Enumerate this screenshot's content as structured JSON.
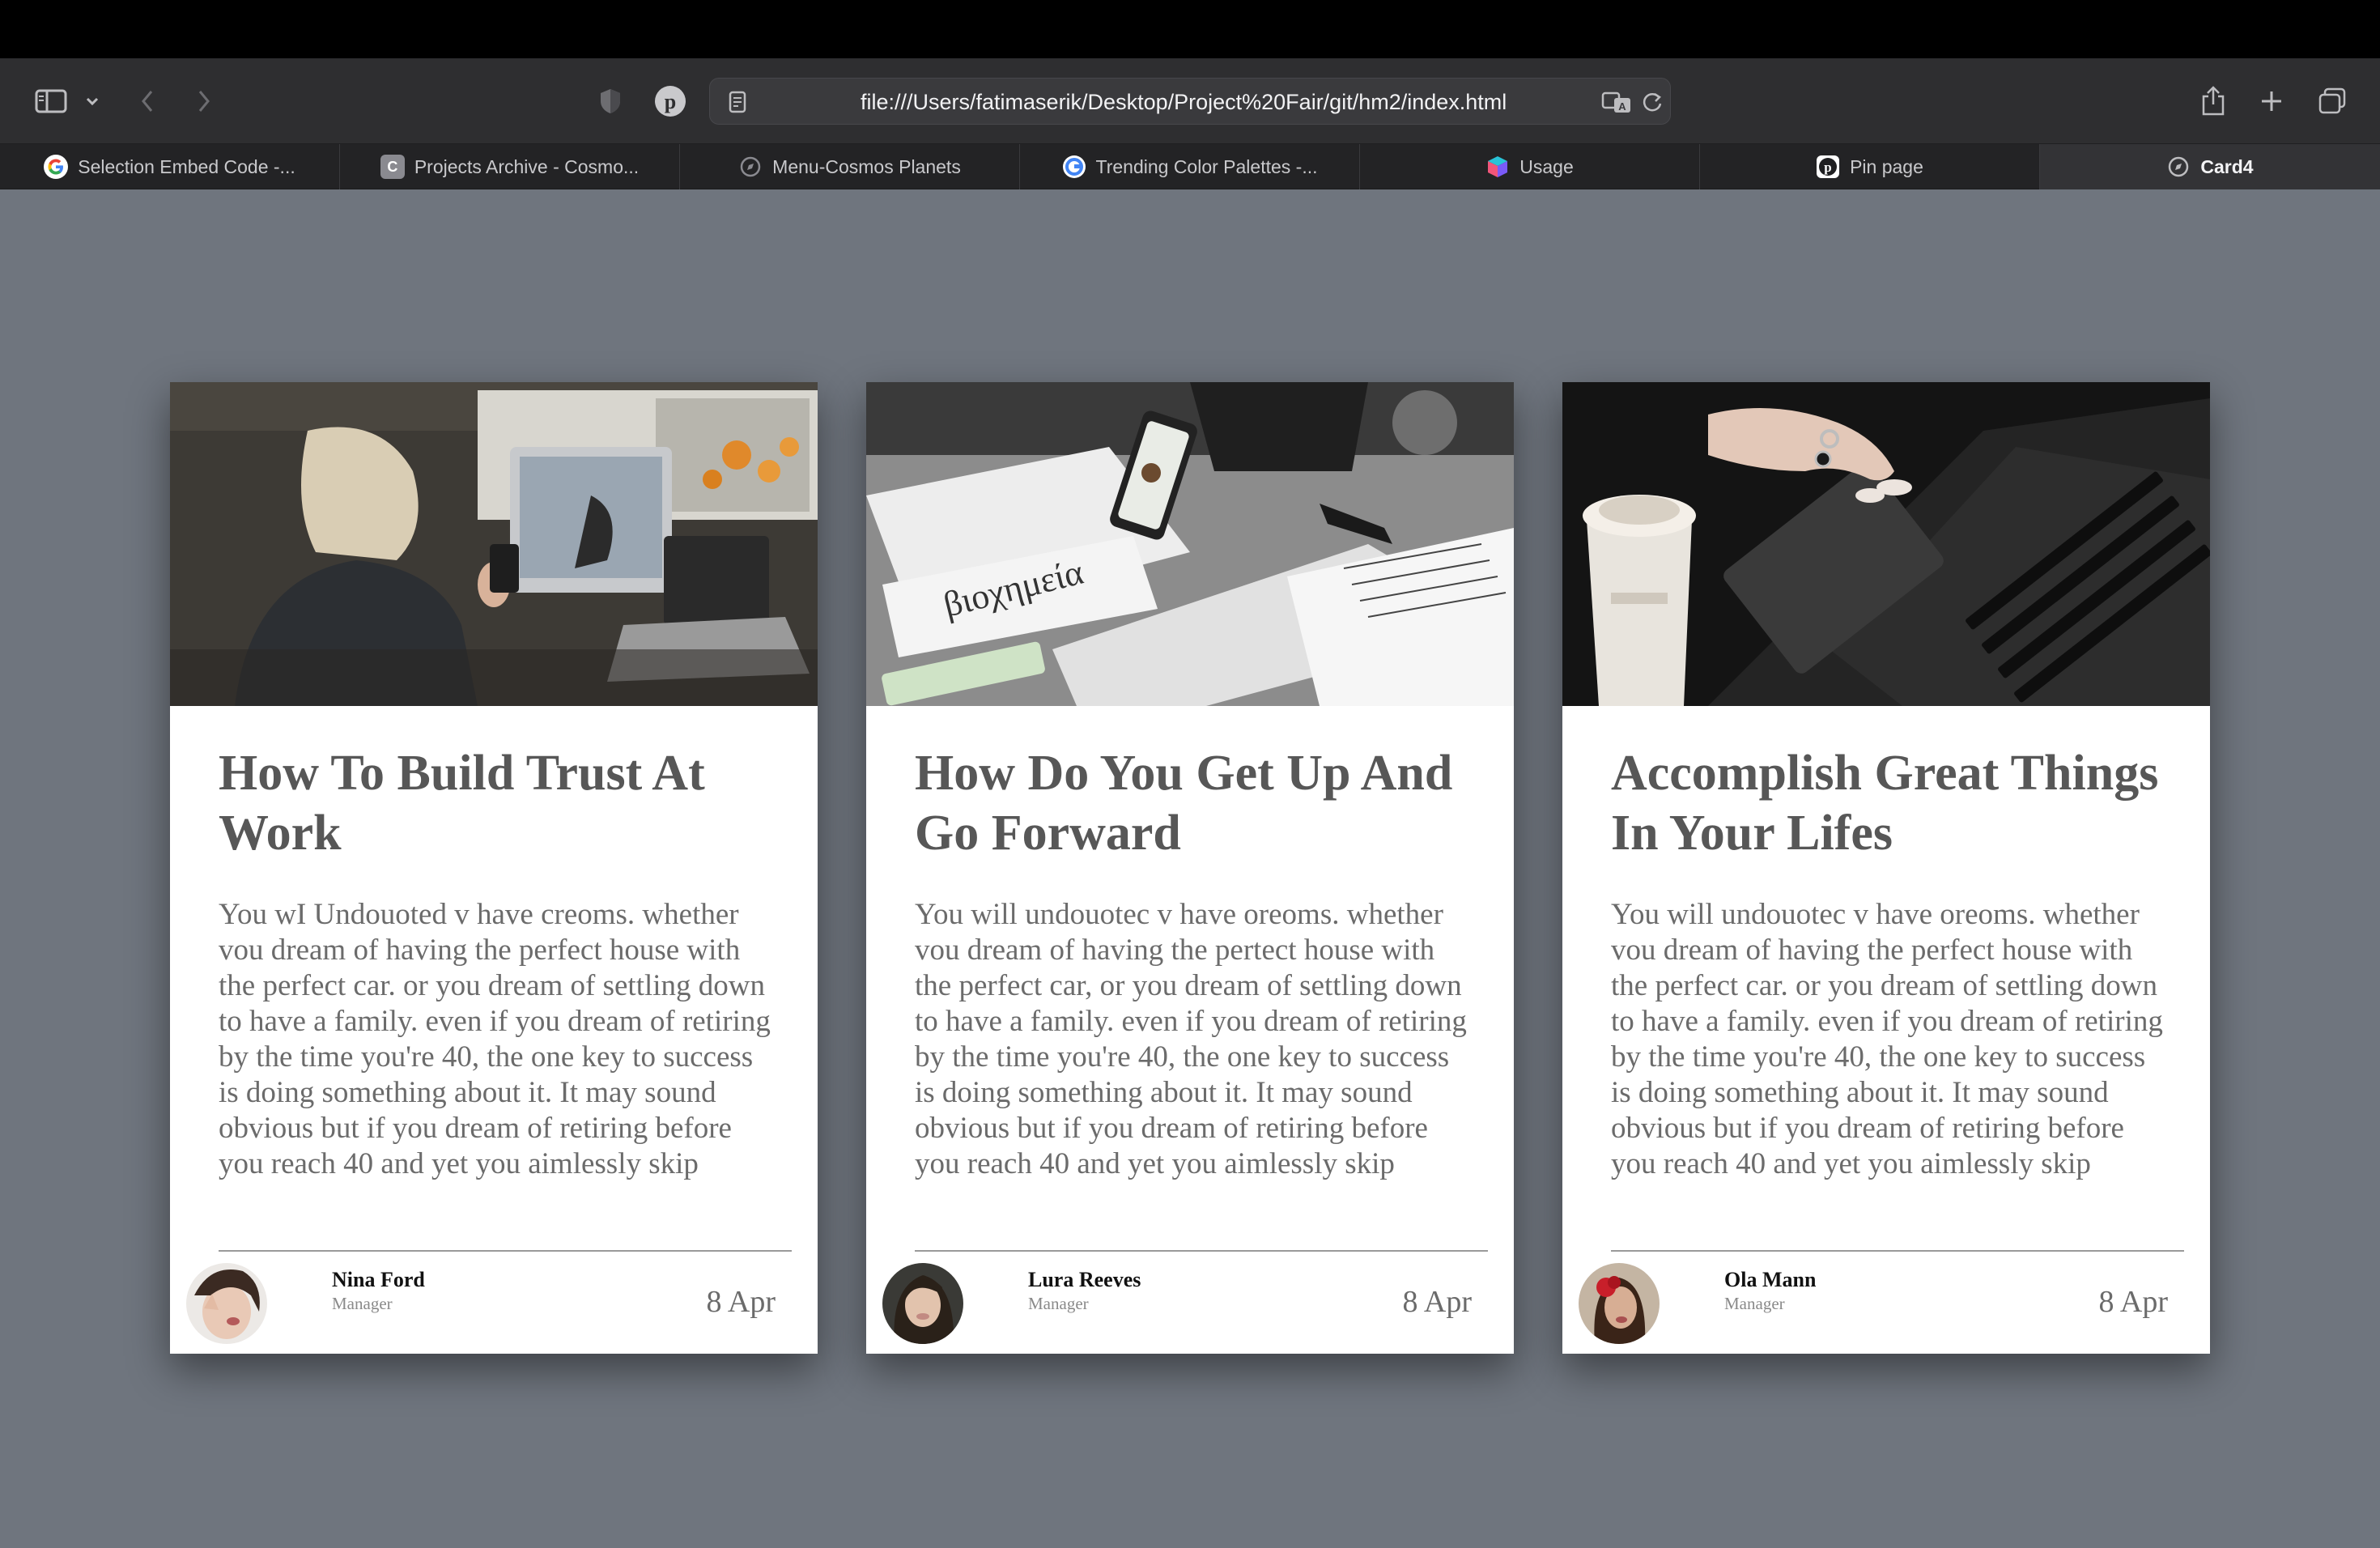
{
  "browser": {
    "url": "file:///Users/fatimaserik/Desktop/Project%20Fair/git/hm2/index.html",
    "tabs": [
      {
        "label": "Selection Embed Code -...",
        "icon": "google-icon",
        "color": "#4285f4"
      },
      {
        "label": "Projects Archive - Cosmo...",
        "icon": "cosmos-c-icon",
        "color": "#8a8a90"
      },
      {
        "label": "Menu-Cosmos Planets",
        "icon": "compass-icon",
        "color": "#8a8a90"
      },
      {
        "label": "Trending Color Palettes -...",
        "icon": "google-icon",
        "color": "#4285f4"
      },
      {
        "label": "Usage",
        "icon": "cube-icon",
        "color": "#29c3d8"
      },
      {
        "label": "Pin page",
        "icon": "pinterest-icon",
        "color": "#e60023"
      },
      {
        "label": "Card4",
        "icon": "compass-icon",
        "color": "#8a8a90",
        "active": true
      }
    ]
  },
  "cards": [
    {
      "title": "How To Build Trust At Work",
      "text": "You wI Undouoted v have creoms. whether vou dream of having the perfect house with the perfect car. or you dream of settling down to have a family. even if you dream of retiring by the time you're 40, the one key to success is doing something about it. It may sound obvious but if you dream of retiring before you reach 40 and yet you aimlessly skip",
      "author": "Nina Ford",
      "role": "Manager",
      "date": "8 Apr"
    },
    {
      "title": "How Do You Get Up And Go Forward",
      "text": "You will undouotec v have oreoms. whether vou dream of having the pertect house with the perfect car, or you dream of settling down to have a family. even if you dream of retiring by the time you're 40, the one key to success is doing something about it. It may sound obvious but if you dream of retiring before you reach 40 and yet you aimlessly skip",
      "author": "Lura Reeves",
      "role": "Manager",
      "date": "8 Apr"
    },
    {
      "title": "Accomplish Great Things In Your Lifes",
      "text": "You will undouotec v have oreoms. whether vou dream of having the perfect house with the perfect car. or you dream of settling down to have a family. even if you dream of retiring by the time you're 40, the one key to success is doing something about it. It may sound obvious but if you dream of retiring before you reach 40 and yet you aimlessly skip",
      "author": "Ola Mann",
      "role": "Manager",
      "date": "8 Apr"
    }
  ]
}
